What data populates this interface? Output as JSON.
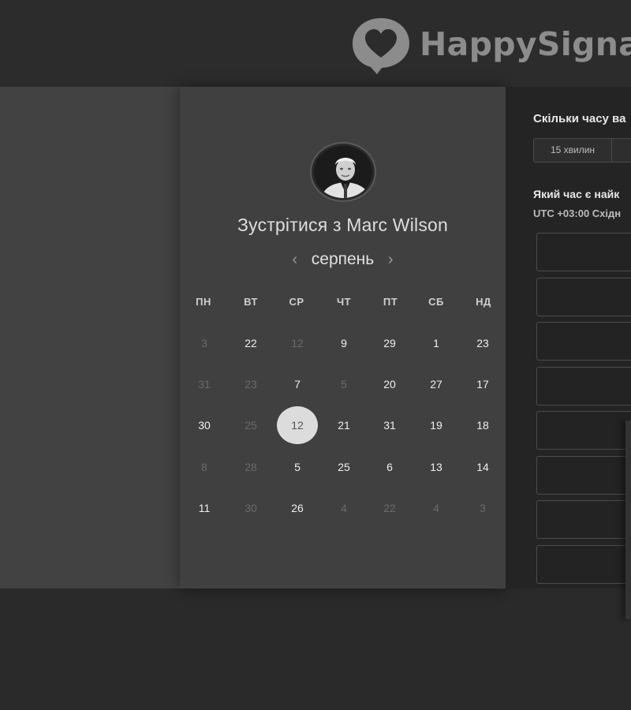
{
  "header": {
    "brand_name": "HappySigna",
    "logo_icon": "heart-speech-bubble-icon"
  },
  "booking": {
    "title": "Зустрітися з Marc Wilson",
    "host_avatar": "host-avatar",
    "month": "серпень",
    "prev_icon": "‹",
    "next_icon": "›",
    "weekdays": [
      "ПН",
      "ВТ",
      "СР",
      "ЧТ",
      "ПТ",
      "СБ",
      "НД"
    ],
    "weeks": [
      [
        {
          "d": "3",
          "muted": true
        },
        {
          "d": "22",
          "muted": false
        },
        {
          "d": "12",
          "muted": true
        },
        {
          "d": "9",
          "muted": false
        },
        {
          "d": "29",
          "muted": false
        },
        {
          "d": "1",
          "muted": false
        },
        {
          "d": "23",
          "muted": false
        }
      ],
      [
        {
          "d": "31",
          "muted": true
        },
        {
          "d": "23",
          "muted": true
        },
        {
          "d": "7",
          "muted": false
        },
        {
          "d": "5",
          "muted": true
        },
        {
          "d": "20",
          "muted": false
        },
        {
          "d": "27",
          "muted": false
        },
        {
          "d": "17",
          "muted": false
        }
      ],
      [
        {
          "d": "30",
          "muted": false
        },
        {
          "d": "25",
          "muted": true
        },
        {
          "d": "12",
          "muted": false,
          "selected": true
        },
        {
          "d": "21",
          "muted": false
        },
        {
          "d": "31",
          "muted": false
        },
        {
          "d": "19",
          "muted": false
        },
        {
          "d": "18",
          "muted": false
        }
      ],
      [
        {
          "d": "8",
          "muted": true
        },
        {
          "d": "28",
          "muted": true
        },
        {
          "d": "5",
          "muted": false
        },
        {
          "d": "25",
          "muted": false
        },
        {
          "d": "6",
          "muted": false
        },
        {
          "d": "13",
          "muted": false
        },
        {
          "d": "14",
          "muted": false
        }
      ],
      [
        {
          "d": "11",
          "muted": false
        },
        {
          "d": "30",
          "muted": true
        },
        {
          "d": "26",
          "muted": false
        },
        {
          "d": "4",
          "muted": true
        },
        {
          "d": "22",
          "muted": true
        },
        {
          "d": "4",
          "muted": true
        },
        {
          "d": "3",
          "muted": true
        }
      ]
    ]
  },
  "schedule": {
    "duration_question": "Скільки часу ва",
    "duration_options": [
      "15 хвилин",
      ""
    ],
    "time_question": "Який час є найк",
    "timezone": "UTC +03:00 Східн",
    "slots": [
      "",
      "",
      "",
      "",
      "",
      "",
      "",
      ""
    ]
  },
  "colors": {
    "page_bg": "#2a2a2a",
    "card_bg": "#404040",
    "panel_bg": "#242424",
    "selected_day": "#dcdcdc",
    "logo": "#8c8c8c"
  }
}
